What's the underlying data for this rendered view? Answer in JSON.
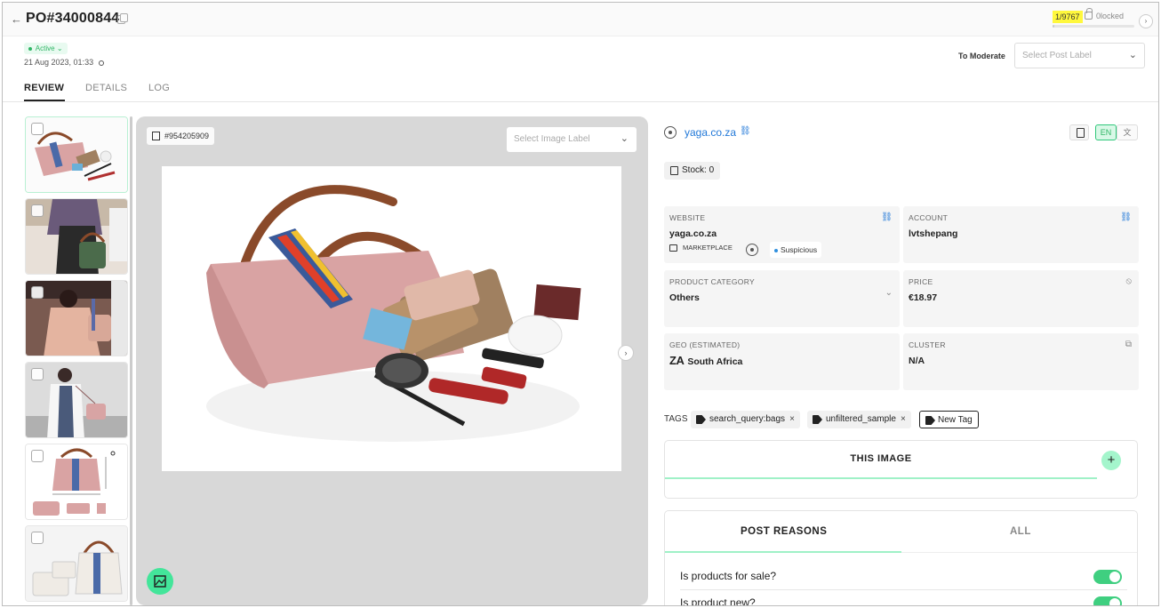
{
  "header": {
    "back_glyph": "←",
    "title": "PO#34000844",
    "counter": "1/9767",
    "clocked_label": "0locked",
    "next_glyph": "›",
    "progress": 0.0001
  },
  "status": {
    "label": "Active",
    "chevron": "⌄",
    "timestamp": "21 Aug 2023, 01:33"
  },
  "moderate": {
    "label": "To Moderate",
    "placeholder": "Select Post Label",
    "chevron": "⌄"
  },
  "tabs": [
    {
      "label": "REVIEW",
      "active": true
    },
    {
      "label": "DETAILS",
      "active": false
    },
    {
      "label": "LOG",
      "active": false
    }
  ],
  "thumbnails": [
    {
      "desc": "pink-bag-spilled-contents-icon",
      "selected": true
    },
    {
      "desc": "woman-with-green-bag-icon",
      "selected": false
    },
    {
      "desc": "woman-pink-dress-bag-icon",
      "selected": false
    },
    {
      "desc": "woman-white-coat-pink-bag-icon",
      "selected": false
    },
    {
      "desc": "pink-bag-set-dimensions-icon",
      "selected": false
    },
    {
      "desc": "white-bag-set-icon",
      "selected": false
    }
  ],
  "viewer": {
    "image_id": "#954205909",
    "label_placeholder": "Select Image Label",
    "chevron": "⌄",
    "next_glyph": "›"
  },
  "site": {
    "name": "yaga.co.za",
    "link_glyph": "🔗",
    "lang_active": "EN",
    "lang_other": "文"
  },
  "stock": "Stock: 0",
  "cards": {
    "website": {
      "label": "WEBSITE",
      "value": "yaga.co.za",
      "marketplace": "MARKETPLACE",
      "flag": "Suspicious"
    },
    "account": {
      "label": "ACCOUNT",
      "value": "lvtshepang"
    },
    "category": {
      "label": "PRODUCT CATEGORY",
      "value": "Others",
      "chevron": "⌄"
    },
    "price": {
      "label": "PRICE",
      "value": "€18.97",
      "icon": "⦸"
    },
    "geo": {
      "label": "GEO (ESTIMATED)",
      "code": "ZA",
      "value": "South Africa"
    },
    "cluster": {
      "label": "CLUSTER",
      "value": "N/A",
      "icon": "⧉"
    }
  },
  "tags": {
    "label": "TAGS",
    "items": [
      "search_query:bags",
      "unfiltered_sample"
    ],
    "remove_glyph": "×",
    "new_label": "New Tag"
  },
  "this_image": {
    "title": "THIS IMAGE",
    "add_glyph": "+"
  },
  "reasons": {
    "tab_active": "POST REASONS",
    "tab_other": "ALL",
    "questions": [
      {
        "text": "Is products for sale?",
        "on": true
      },
      {
        "text": "Is product new?",
        "on": true
      }
    ]
  },
  "colors": {
    "accent_green": "#43e59a",
    "link_blue": "#2178d8",
    "highlight_yellow": "#fff83d"
  }
}
